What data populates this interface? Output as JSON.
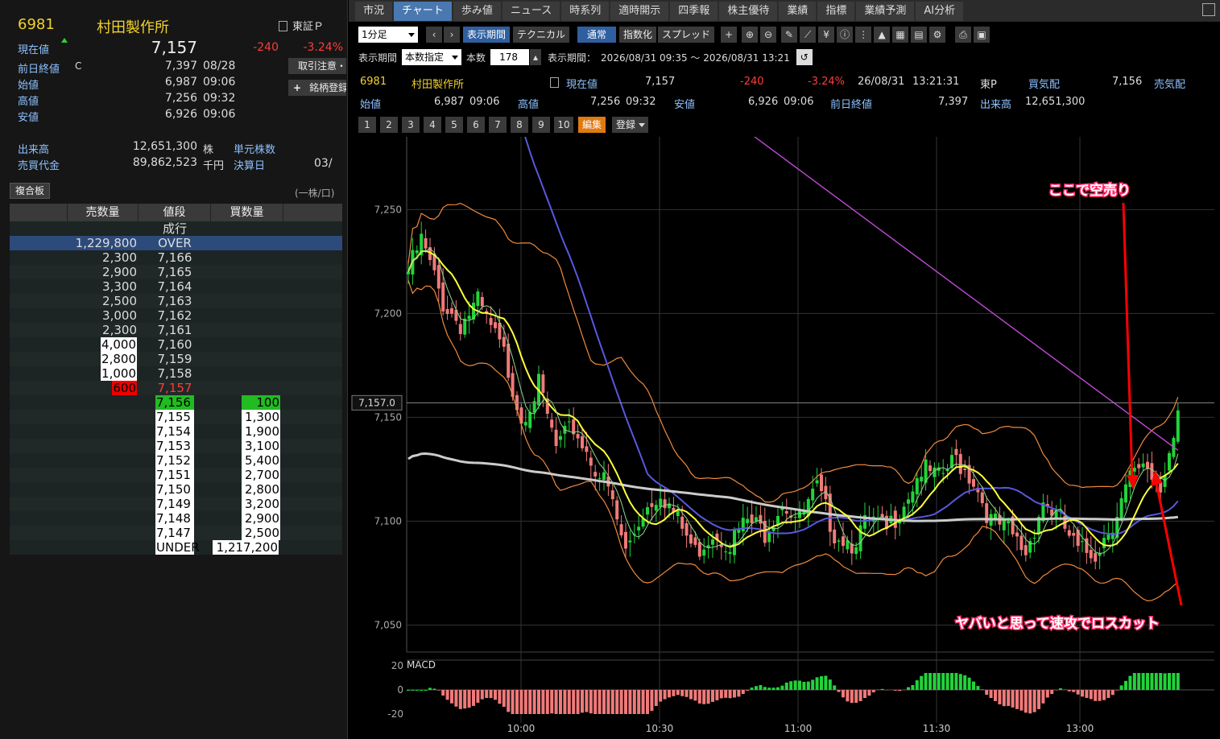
{
  "stock": {
    "code": "6981",
    "name": "村田製作所",
    "exchange": "東証Ｐ",
    "current_label": "現在値",
    "current_price": "7,157",
    "change": "-240",
    "change_pct": "-3.24%",
    "prev_close_label": "前日終値",
    "prev_close_flag": "C",
    "prev_close": "7,397",
    "prev_close_date": "08/28",
    "open_label": "始値",
    "open": "6,987",
    "open_time": "09:06",
    "high_label": "高値",
    "high": "7,256",
    "high_time": "09:32",
    "low_label": "安値",
    "low": "6,926",
    "low_time": "09:06",
    "volume_label": "出来高",
    "volume": "12,651,300",
    "volume_unit": "株",
    "unit_shares_label": "単元株数",
    "turnover_label": "売買代金",
    "turnover": "89,862,523",
    "turnover_unit": "千円",
    "settlement_label": "決算日",
    "settlement": "03/"
  },
  "side_buttons": {
    "caution": "取引注意・",
    "register": "銘柄登録"
  },
  "book": {
    "button": "複合板",
    "unit_note": "(一株/口)",
    "headers": [
      "売数量",
      "値段",
      "買数量"
    ],
    "market_order": "成行",
    "rows": [
      {
        "sell": "1,229,800",
        "price": "OVER",
        "buy": ""
      },
      {
        "sell": "2,300",
        "price": "7,166",
        "buy": ""
      },
      {
        "sell": "2,900",
        "price": "7,165",
        "buy": ""
      },
      {
        "sell": "3,300",
        "price": "7,164",
        "buy": ""
      },
      {
        "sell": "2,500",
        "price": "7,163",
        "buy": ""
      },
      {
        "sell": "3,000",
        "price": "7,162",
        "buy": ""
      },
      {
        "sell": "2,300",
        "price": "7,161",
        "buy": ""
      },
      {
        "sell": "4,000",
        "price": "7,160",
        "buy": ""
      },
      {
        "sell": "2,800",
        "price": "7,159",
        "buy": ""
      },
      {
        "sell": "1,000",
        "price": "7,158",
        "buy": ""
      },
      {
        "sell": "600",
        "price": "7,157",
        "buy": ""
      },
      {
        "sell": "",
        "price": "7,156",
        "buy": "100"
      },
      {
        "sell": "",
        "price": "7,155",
        "buy": "1,300"
      },
      {
        "sell": "",
        "price": "7,154",
        "buy": "1,900"
      },
      {
        "sell": "",
        "price": "7,153",
        "buy": "3,100"
      },
      {
        "sell": "",
        "price": "7,152",
        "buy": "5,400"
      },
      {
        "sell": "",
        "price": "7,151",
        "buy": "2,700"
      },
      {
        "sell": "",
        "price": "7,150",
        "buy": "2,800"
      },
      {
        "sell": "",
        "price": "7,149",
        "buy": "3,200"
      },
      {
        "sell": "",
        "price": "7,148",
        "buy": "2,900"
      },
      {
        "sell": "",
        "price": "7,147",
        "buy": "2,500"
      },
      {
        "sell": "",
        "price": "UNDER",
        "buy": "1,217,200"
      }
    ]
  },
  "tabs": [
    "市況",
    "チャート",
    "歩み値",
    "ニュース",
    "時系列",
    "適時開示",
    "四季報",
    "株主優待",
    "業績",
    "指標",
    "業績予測",
    "AI分析"
  ],
  "active_tab": "チャート",
  "toolbar": {
    "interval": "1分足",
    "period_btn": "表示期間",
    "technical_btn": "テクニカル",
    "normal_btn": "通常",
    "index_btn": "指数化",
    "spread_btn": "スプレッド",
    "display_period_label": "表示期間",
    "display_mode": "本数指定",
    "count_label": "本数",
    "count": "178",
    "range_label": "表示期間：",
    "range": "2026/08/31 09:35 〜 2026/08/31 13:21",
    "presets": [
      "1",
      "2",
      "3",
      "4",
      "5",
      "6",
      "7",
      "8",
      "9",
      "10"
    ],
    "edit_btn": "編集",
    "register_btn": "登録"
  },
  "quote_bar": {
    "date": "26/08/31",
    "time": "13:21:31",
    "exchange_short": "東P",
    "bid_label": "買気配",
    "bid": "7,156",
    "ask_label": "売気配"
  },
  "chart_data": {
    "type": "candlestick",
    "y_ticks": [
      "7,250",
      "7,200",
      "7,150",
      "7,100",
      "7,050"
    ],
    "y_tick_values": [
      7250,
      7200,
      7150,
      7100,
      7050
    ],
    "ylim": [
      7037,
      7285
    ],
    "x_ticks": [
      "10:00",
      "10:30",
      "11:00",
      "11:30",
      "13:00"
    ],
    "current_price_label": "7,157.0",
    "current_price": 7157,
    "macd_label": "MACD",
    "macd_ticks": [
      "20",
      "0",
      "-20"
    ],
    "macd_tick_values": [
      20,
      0,
      -20
    ],
    "annotations": {
      "short_entry": "ここで空売り",
      "stop_loss": "ヤバいと思って速攻でロスカット"
    },
    "colors": {
      "up": "#22d43a",
      "down": "#f07a7a",
      "ema_short": "#ffff3a",
      "sma_mid": "#5858e0",
      "sma_long": "#cccccc",
      "trend": "#c04ad6",
      "bollinger": "#f08a3c",
      "annotation": "#ff2a6a"
    }
  }
}
